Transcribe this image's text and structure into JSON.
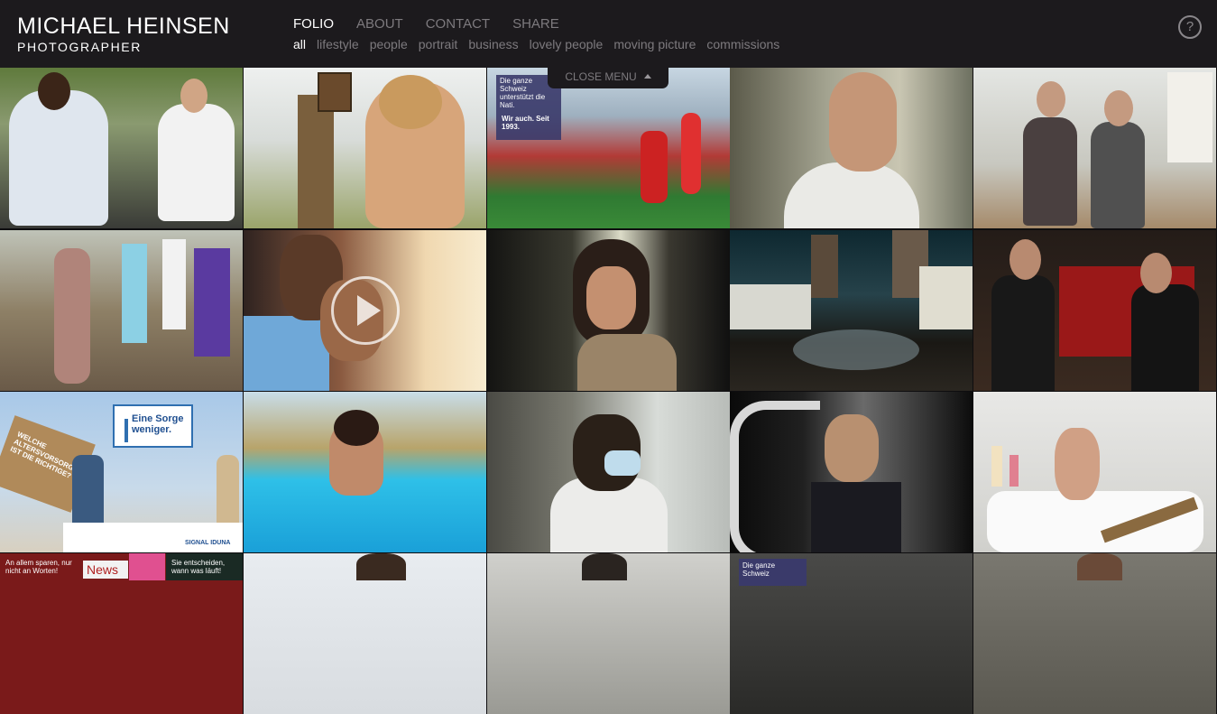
{
  "header": {
    "brand_name": "MICHAEL HEINSEN",
    "brand_sub": "PHOTOGRAPHER",
    "nav": [
      "FOLIO",
      "ABOUT",
      "CONTACT",
      "SHARE"
    ],
    "subnav": [
      "all",
      "lifestyle",
      "people",
      "portrait",
      "business",
      "lovely people",
      "moving picture",
      "commissions"
    ],
    "help": "?"
  },
  "close_menu": "CLOSE MENU",
  "tiles": {
    "t3_ad": "Die ganze Schweiz unterstützt die Nati.",
    "t3_ad2": "Wir auch. Seit 1993.",
    "t11_title": "Eine Sorge weniger.",
    "t11_box": "WELCHE ALTERSVORSORGE IST DIE RICHTIGE?",
    "t11_brand": "SIGNAL IDUNA",
    "t16_text": "An allem sparen, nur nicht an Worten!",
    "t16_news": "News",
    "t16_text2": "Sie entscheiden, wann was läuft!",
    "t19_text": "Die ganze Schweiz"
  },
  "colors": {
    "topbar": "#1c1a1d",
    "active": "#ffffff",
    "inactive": "#7d7a7e"
  }
}
